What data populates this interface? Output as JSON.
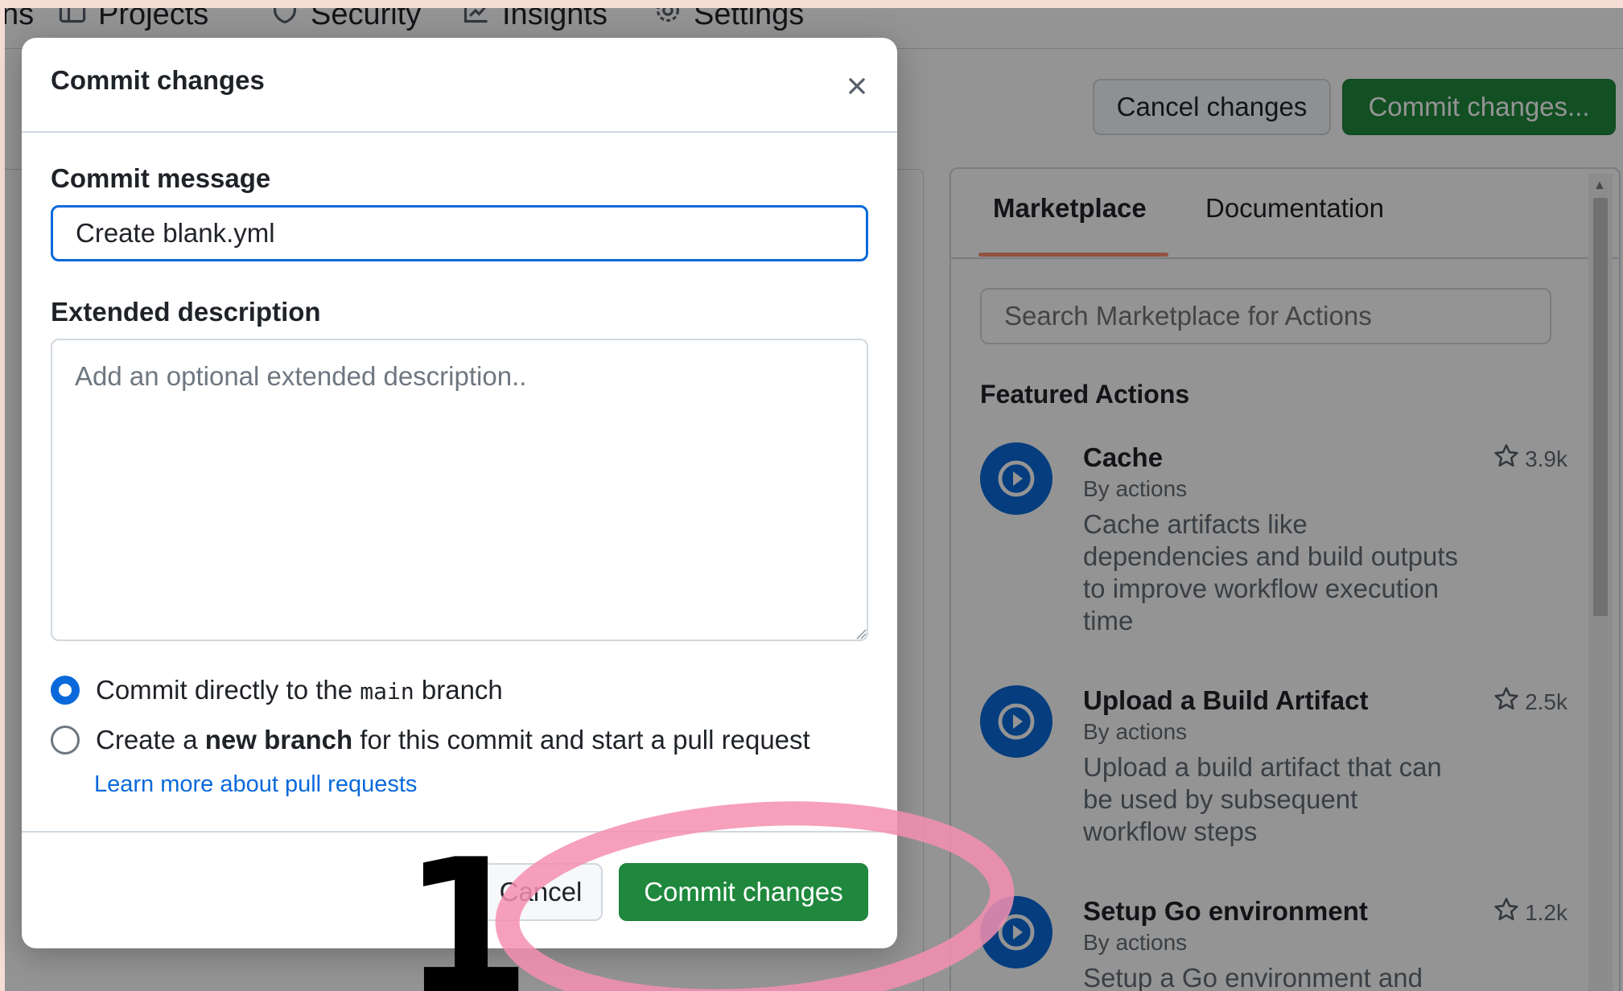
{
  "topnav": {
    "items": [
      {
        "label": "ns",
        "icon": ""
      },
      {
        "label": "Projects",
        "icon": "table-icon"
      },
      {
        "label": "Security",
        "icon": "shield-icon"
      },
      {
        "label": "Insights",
        "icon": "graph-icon"
      },
      {
        "label": "Settings",
        "icon": "gear-icon"
      }
    ]
  },
  "toolbar": {
    "cancel_label": "Cancel changes",
    "commit_label": "Commit changes..."
  },
  "sidebar": {
    "tabs": [
      "Marketplace",
      "Documentation"
    ],
    "search_placeholder": "Search Marketplace for Actions",
    "featured_title": "Featured Actions",
    "actions": [
      {
        "name": "Cache",
        "by": "By actions",
        "description": "Cache artifacts like dependencies and build outputs to improve workflow execution time",
        "stars": "3.9k"
      },
      {
        "name": "Upload a Build Artifact",
        "by": "By actions",
        "description": "Upload a build artifact that can be used by subsequent workflow steps",
        "stars": "2.5k"
      },
      {
        "name": "Setup Go environment",
        "by": "By actions",
        "description": "Setup a Go environment and",
        "stars": "1.2k"
      }
    ]
  },
  "modal": {
    "title": "Commit changes",
    "commit_message_label": "Commit message",
    "commit_message_value": "Create blank.yml",
    "extended_description_label": "Extended description",
    "extended_description_placeholder": "Add an optional extended description..",
    "option_direct_prefix": "Commit directly to the",
    "option_direct_branch": "main",
    "option_direct_suffix": "branch",
    "option_new_prefix": "Create a",
    "option_new_bold": "new branch",
    "option_new_suffix": "for this commit and start a pull request",
    "learn_more": "Learn more about pull requests",
    "cancel_label": "Cancel",
    "commit_label": "Commit changes"
  },
  "annotation": {
    "step_number": "1",
    "highlight_color": "#f48fb1"
  }
}
